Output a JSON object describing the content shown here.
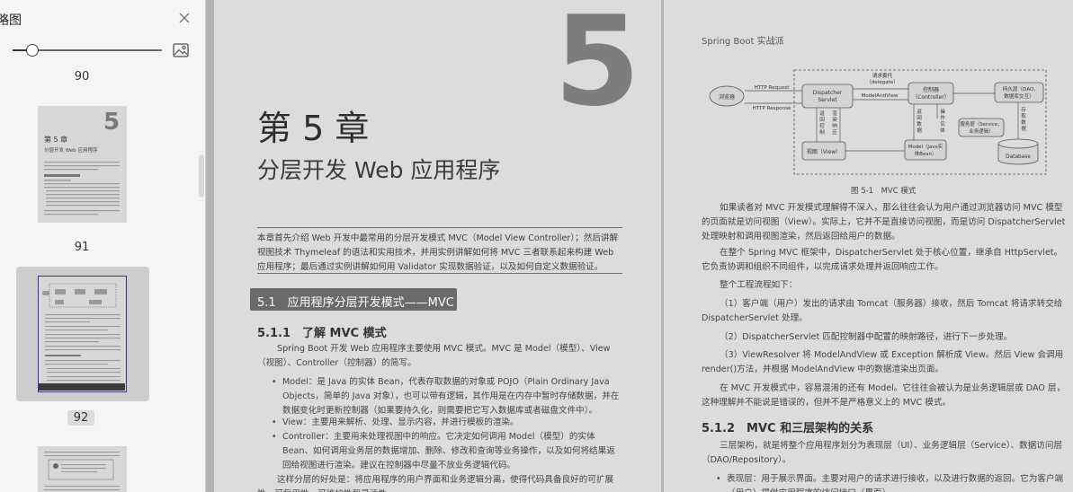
{
  "sidebar": {
    "title": "略图",
    "zoom_start": ")",
    "page_numbers": [
      "90",
      "91",
      "92"
    ],
    "selected_page": "92"
  },
  "left_page": {
    "big_number": "5",
    "chapter_title": "第 5 章",
    "chapter_subtitle": "分层开发 Web 应用程序",
    "intro": "本章首先介绍 Web 开发中最常用的分层开发模式 MVC（Model View Controller）；然后讲解视图技术 Thymeleaf 的语法和实用技术，并用实例讲解如何将 MVC 三者联系起来构建 Web 应用程序；最后通过实例讲解如何用 Validator 实现数据验证，以及如何自定义数据验证。",
    "section_title": "5.1　应用程序分层开发模式——MVC",
    "subsection_title": "5.1.1　了解 MVC 模式",
    "para1": "Spring Boot 开发 Web 应用程序主要使用 MVC 模式。MVC 是 Model（模型）、View（视图）、Controller（控制器）的简写。",
    "bullets": [
      "Model：是 Java 的实体 Bean，代表存取数据的对象或 POJO（Plain Ordinary Java Objects，简单的 Java 对象），也可以带有逻辑，其作用是在内存中暂时存储数据，并在数据变化时更新控制器（如果要持久化，则需要把它写入数据库或者磁盘文件中）。",
      "View：主要用来解析、处理、显示内容，并进行模板的渲染。",
      "Controller：主要用来处理视图中的响应。它决定如何调用 Model（模型）的实体 Bean、如何调用业务层的数据增加、删除、修改和查询等业务操作，以及如何将结果返回给视图进行渲染。建议在控制器中尽量不放业务逻辑代码。"
    ],
    "para2": "这样分层的好处是：将应用程序的用户界面和业务逻辑分离，使得代码具备良好的可扩展性、可复用性、可维护性和灵活性。"
  },
  "right_page": {
    "header": "Spring Boot 实战派",
    "figure": {
      "caption": "图 5-1　MVC 模式",
      "browser": "浏览器",
      "http_request": "HTTP Request",
      "http_response": "HTTP Response",
      "dispatcher": [
        "Dispatcher",
        "Servlet"
      ],
      "delegate": [
        "请求委托",
        "（delegate）"
      ],
      "model_and_view": "ModelAndView",
      "controller": [
        "控制器",
        "（Controller）"
      ],
      "persistence": [
        "持久层（DAO,",
        "数据库交互）"
      ],
      "return_control": [
        "返",
        "回",
        "控",
        "制"
      ],
      "render_response": [
        "渲",
        "染",
        "响",
        "应"
      ],
      "return_data": [
        "返",
        "回",
        "数",
        "据"
      ],
      "operate_entity": [
        "操",
        "作",
        "实",
        "体"
      ],
      "store_data": [
        "存",
        "取",
        "数",
        "据"
      ],
      "service": [
        "服务层（Service，",
        "业务逻辑）"
      ],
      "view": "视图（View）",
      "model": [
        "Model（Java实",
        "体Bean）"
      ],
      "database": "Database"
    },
    "paragraphs": [
      "如果读者对 MVC 开发模式理解得不深入，那么往往会认为用户通过浏览器访问 MVC 模型的页面就是访问视图（View）。实际上，它并不是直接访问视图，而是访问 DispatcherServlet 处理映射和调用视图渲染，然后返回给用户的数据。",
      "在整个 Spring MVC 框架中，DispatcherServlet 处于核心位置，继承自 HttpServlet。它负责协调和组织不同组件，以完成请求处理并返回响应工作。",
      "整个工程流程如下：",
      "（1）客户端（用户）发出的请求由 Tomcat（服务器）接收，然后 Tomcat 将请求转交给 DispatcherServlet 处理。",
      "（2）DispatcherServlet 匹配控制器中配置的映射路径，进行下一步处理。",
      "（3）ViewResolver 将 ModelAndView 或 Exception 解析成 View。然后 View 会调用 render()方法，并根据 ModelAndView 中的数据渲染出页面。",
      "在 MVC 开发模式中，容易混淆的还有 Model。它往往会被认为是业务逻辑层或 DAO 层，这种理解并不能说是错误的，但并不是严格意义上的 MVC 模式。"
    ],
    "subsection_title": "5.1.2　MVC 和三层架构的关系",
    "para_arch": "三层架构，就是将整个应用程序划分为表现层（UI）、业务逻辑层（Service）、数据访问层（DAO/Repository）。",
    "bullet": "表现层：用于展示界面。主要对用户的请求进行接收，以及进行数据的返回。它为客户端（用户）提供应用程序的访问接口（界面）。"
  }
}
